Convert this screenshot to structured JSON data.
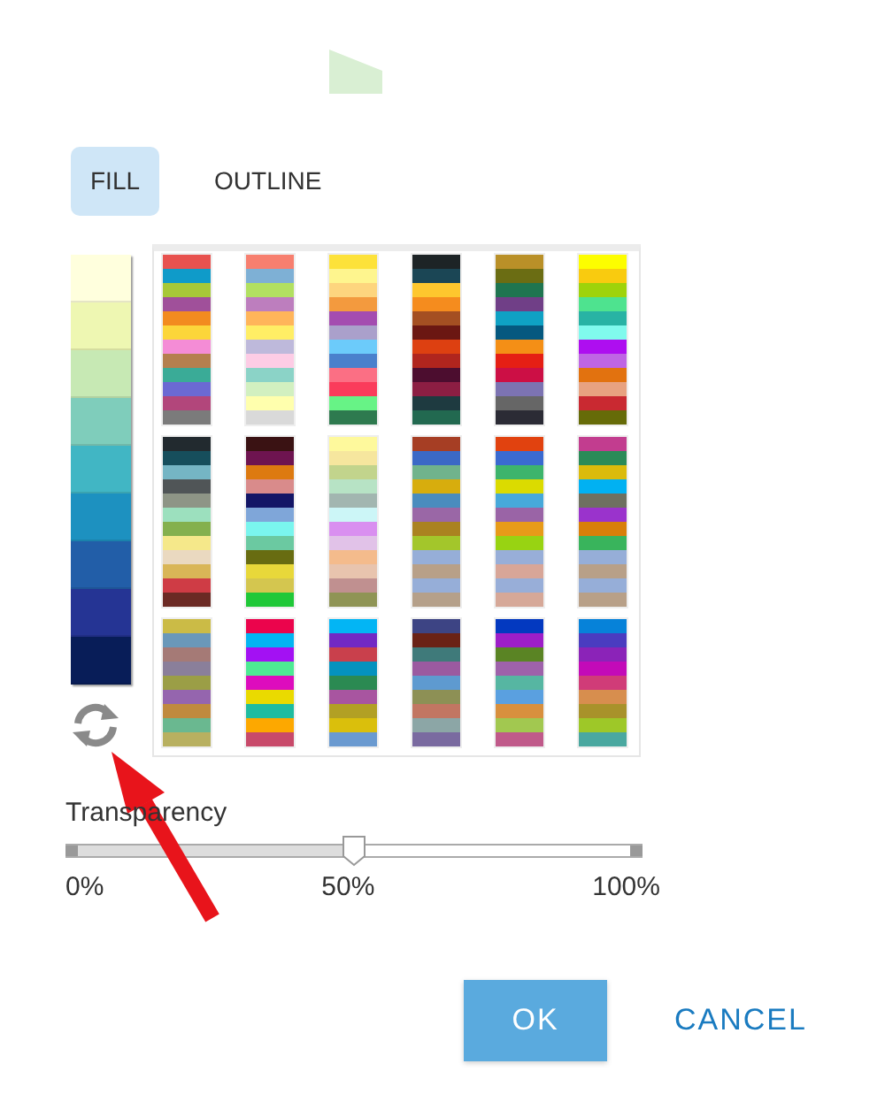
{
  "tabs": [
    {
      "label": "FILL",
      "selected": true
    },
    {
      "label": "OUTLINE",
      "selected": false
    }
  ],
  "current_ramp": [
    {
      "color": "#ffffdd"
    },
    {
      "color": "#eef7b2"
    },
    {
      "color": "#c7e9b4"
    },
    {
      "color": "#7fcdbb"
    },
    {
      "color": "#41b6c4"
    },
    {
      "color": "#1d91c0"
    },
    {
      "color": "#225ea8"
    },
    {
      "color": "#253494"
    },
    {
      "color": "#081d58"
    }
  ],
  "palettes": [
    {
      "swatches": [
        {
          "color": "#e8524f"
        },
        {
          "color": "#0f9bc9"
        },
        {
          "color": "#a7c838"
        },
        {
          "color": "#a0509a"
        },
        {
          "color": "#f28b1f"
        },
        {
          "color": "#fcd63a"
        },
        {
          "color": "#f48cd6"
        },
        {
          "color": "#b47f4e"
        },
        {
          "color": "#3aab97"
        },
        {
          "color": "#6b69d3"
        },
        {
          "color": "#b2467b"
        },
        {
          "color": "#7b7b7b"
        }
      ]
    },
    {
      "swatches": [
        {
          "color": "#f77f6f"
        },
        {
          "color": "#7eb0d5"
        },
        {
          "color": "#b2e061"
        },
        {
          "color": "#bd7ebe"
        },
        {
          "color": "#ffb55a"
        },
        {
          "color": "#ffee65"
        },
        {
          "color": "#beb9db"
        },
        {
          "color": "#fdcce5"
        },
        {
          "color": "#8bd3c7"
        },
        {
          "color": "#d2f0c0"
        },
        {
          "color": "#ffffad"
        },
        {
          "color": "#d9d9d9"
        }
      ]
    },
    {
      "swatches": [
        {
          "color": "#fde23a"
        },
        {
          "color": "#fef58e"
        },
        {
          "color": "#fdd57e"
        },
        {
          "color": "#f39a3e"
        },
        {
          "color": "#a44cb0"
        },
        {
          "color": "#aaa0cb"
        },
        {
          "color": "#6ccbfa"
        },
        {
          "color": "#4a80cc"
        },
        {
          "color": "#fb6f84"
        },
        {
          "color": "#fa3c5b"
        },
        {
          "color": "#67f386"
        },
        {
          "color": "#2e7a4f"
        }
      ]
    },
    {
      "swatches": [
        {
          "color": "#1d2426"
        },
        {
          "color": "#1b4655"
        },
        {
          "color": "#fec72e"
        },
        {
          "color": "#f58c1e"
        },
        {
          "color": "#a44f22"
        },
        {
          "color": "#6b1712"
        },
        {
          "color": "#dd4011"
        },
        {
          "color": "#b0251e"
        },
        {
          "color": "#4c0d2f"
        },
        {
          "color": "#8c1e43"
        },
        {
          "color": "#1e3a40"
        },
        {
          "color": "#226950"
        }
      ]
    },
    {
      "swatches": [
        {
          "color": "#b99028"
        },
        {
          "color": "#6b6d13"
        },
        {
          "color": "#1f7550"
        },
        {
          "color": "#703f87"
        },
        {
          "color": "#0fa1c4"
        },
        {
          "color": "#05587f"
        },
        {
          "color": "#f48f16"
        },
        {
          "color": "#e51f14"
        },
        {
          "color": "#cc0f45"
        },
        {
          "color": "#7c73b2"
        },
        {
          "color": "#666666"
        },
        {
          "color": "#2b2b35"
        }
      ]
    },
    {
      "swatches": [
        {
          "color": "#fdfd00"
        },
        {
          "color": "#f9cb0f"
        },
        {
          "color": "#9fd30a"
        },
        {
          "color": "#4ee38f"
        },
        {
          "color": "#28b3a4"
        },
        {
          "color": "#80faed"
        },
        {
          "color": "#ae0ef0"
        },
        {
          "color": "#bf65e4"
        },
        {
          "color": "#e2720f"
        },
        {
          "color": "#e8a280"
        },
        {
          "color": "#c92931"
        },
        {
          "color": "#666b08"
        }
      ]
    },
    {
      "swatches": [
        {
          "color": "#222a2f"
        },
        {
          "color": "#164e5c"
        },
        {
          "color": "#75b5c4"
        },
        {
          "color": "#505557"
        },
        {
          "color": "#8e9586"
        },
        {
          "color": "#9ce0be"
        },
        {
          "color": "#84b04e"
        },
        {
          "color": "#f5e88a"
        },
        {
          "color": "#ead9c0"
        },
        {
          "color": "#d9b657"
        },
        {
          "color": "#cf3c45"
        },
        {
          "color": "#6b2a24"
        }
      ]
    },
    {
      "swatches": [
        {
          "color": "#3a1213"
        },
        {
          "color": "#6e1450"
        },
        {
          "color": "#dd7a10"
        },
        {
          "color": "#d98b8b"
        },
        {
          "color": "#141666"
        },
        {
          "color": "#7fa6d9"
        },
        {
          "color": "#7af5ee"
        },
        {
          "color": "#6bc9a1"
        },
        {
          "color": "#686c11"
        },
        {
          "color": "#e8d83a"
        },
        {
          "color": "#d4c64f"
        },
        {
          "color": "#20c838"
        }
      ]
    },
    {
      "swatches": [
        {
          "color": "#fef99c"
        },
        {
          "color": "#f6e69e"
        },
        {
          "color": "#c2d48c"
        },
        {
          "color": "#b7e3c5"
        },
        {
          "color": "#a2b6b0"
        },
        {
          "color": "#ccf6f7"
        },
        {
          "color": "#d98ff0"
        },
        {
          "color": "#e1c2e8"
        },
        {
          "color": "#f4bb8c"
        },
        {
          "color": "#e8c4ae"
        },
        {
          "color": "#c09090"
        },
        {
          "color": "#8f9455"
        }
      ]
    },
    {
      "swatches": [
        {
          "color": "#a63e24"
        },
        {
          "color": "#3b69c6"
        },
        {
          "color": "#70b38c"
        },
        {
          "color": "#d7ad0d"
        },
        {
          "color": "#4a8cbe"
        },
        {
          "color": "#9a67a6"
        },
        {
          "color": "#aa8220"
        },
        {
          "color": "#a3c62b"
        },
        {
          "color": "#96aed8"
        },
        {
          "color": "#b8a088"
        },
        {
          "color": "#96aed8"
        },
        {
          "color": "#b5a08a"
        }
      ]
    },
    {
      "swatches": [
        {
          "color": "#e1420f"
        },
        {
          "color": "#3a6ad0"
        },
        {
          "color": "#3db46c"
        },
        {
          "color": "#dbdb00"
        },
        {
          "color": "#47a9da"
        },
        {
          "color": "#9a64a6"
        },
        {
          "color": "#e79b19"
        },
        {
          "color": "#98d312"
        },
        {
          "color": "#98aed8"
        },
        {
          "color": "#d8a698"
        },
        {
          "color": "#98aed8"
        },
        {
          "color": "#d6a898"
        }
      ]
    },
    {
      "swatches": [
        {
          "color": "#c23d8f"
        },
        {
          "color": "#2b8b58"
        },
        {
          "color": "#dbbb0c"
        },
        {
          "color": "#01b1f2"
        },
        {
          "color": "#6e7060"
        },
        {
          "color": "#9a33cc"
        },
        {
          "color": "#d87f0a"
        },
        {
          "color": "#39b45c"
        },
        {
          "color": "#96aed8"
        },
        {
          "color": "#b8a088"
        },
        {
          "color": "#96aed8"
        },
        {
          "color": "#b8a088"
        }
      ]
    },
    {
      "swatches": [
        {
          "color": "#cbbb46"
        },
        {
          "color": "#6a98b9"
        },
        {
          "color": "#a57a76"
        },
        {
          "color": "#8a7f9a"
        },
        {
          "color": "#9b9e46"
        },
        {
          "color": "#9565ae"
        },
        {
          "color": "#c08a3e"
        },
        {
          "color": "#6ab890"
        },
        {
          "color": "#b8b060"
        }
      ]
    },
    {
      "swatches": [
        {
          "color": "#eb044c"
        },
        {
          "color": "#03b5f2"
        },
        {
          "color": "#a311f3"
        },
        {
          "color": "#4dea93"
        },
        {
          "color": "#dd0cbd"
        },
        {
          "color": "#eada00"
        },
        {
          "color": "#1fbca0"
        },
        {
          "color": "#fda800"
        },
        {
          "color": "#c84a6a"
        }
      ]
    },
    {
      "swatches": [
        {
          "color": "#03b5f4"
        },
        {
          "color": "#7229c4"
        },
        {
          "color": "#c9404c"
        },
        {
          "color": "#0592be"
        },
        {
          "color": "#2b8a52"
        },
        {
          "color": "#a855a0"
        },
        {
          "color": "#b2a024"
        },
        {
          "color": "#dabf0c"
        },
        {
          "color": "#6a9ad0"
        }
      ]
    },
    {
      "swatches": [
        {
          "color": "#3d4484"
        },
        {
          "color": "#6a2216"
        },
        {
          "color": "#3f7a7a"
        },
        {
          "color": "#9b5aa0"
        },
        {
          "color": "#5e9ad0"
        },
        {
          "color": "#8d9055"
        },
        {
          "color": "#c27662"
        },
        {
          "color": "#8ca6a6"
        },
        {
          "color": "#7a6aa0"
        }
      ]
    },
    {
      "swatches": [
        {
          "color": "#0339c0"
        },
        {
          "color": "#9d1ec8"
        },
        {
          "color": "#5a8424"
        },
        {
          "color": "#9e62aa"
        },
        {
          "color": "#56b6a2"
        },
        {
          "color": "#5aa0e0"
        },
        {
          "color": "#d8903e"
        },
        {
          "color": "#a2c850"
        },
        {
          "color": "#c05a8a"
        }
      ]
    },
    {
      "swatches": [
        {
          "color": "#0682d9"
        },
        {
          "color": "#4a3cc0"
        },
        {
          "color": "#8b23b8"
        },
        {
          "color": "#c30ab8"
        },
        {
          "color": "#d03c78"
        },
        {
          "color": "#d78e4e"
        },
        {
          "color": "#a8922a"
        },
        {
          "color": "#9ec828"
        },
        {
          "color": "#4aa8a0"
        }
      ]
    }
  ],
  "transparency": {
    "label": "Transparency",
    "level": 0.5,
    "ticks": [
      "0%",
      "50%",
      "100%"
    ]
  },
  "buttons": [
    {
      "label": "OK",
      "kind": "primary"
    },
    {
      "label": "CANCEL",
      "kind": "link"
    }
  ]
}
